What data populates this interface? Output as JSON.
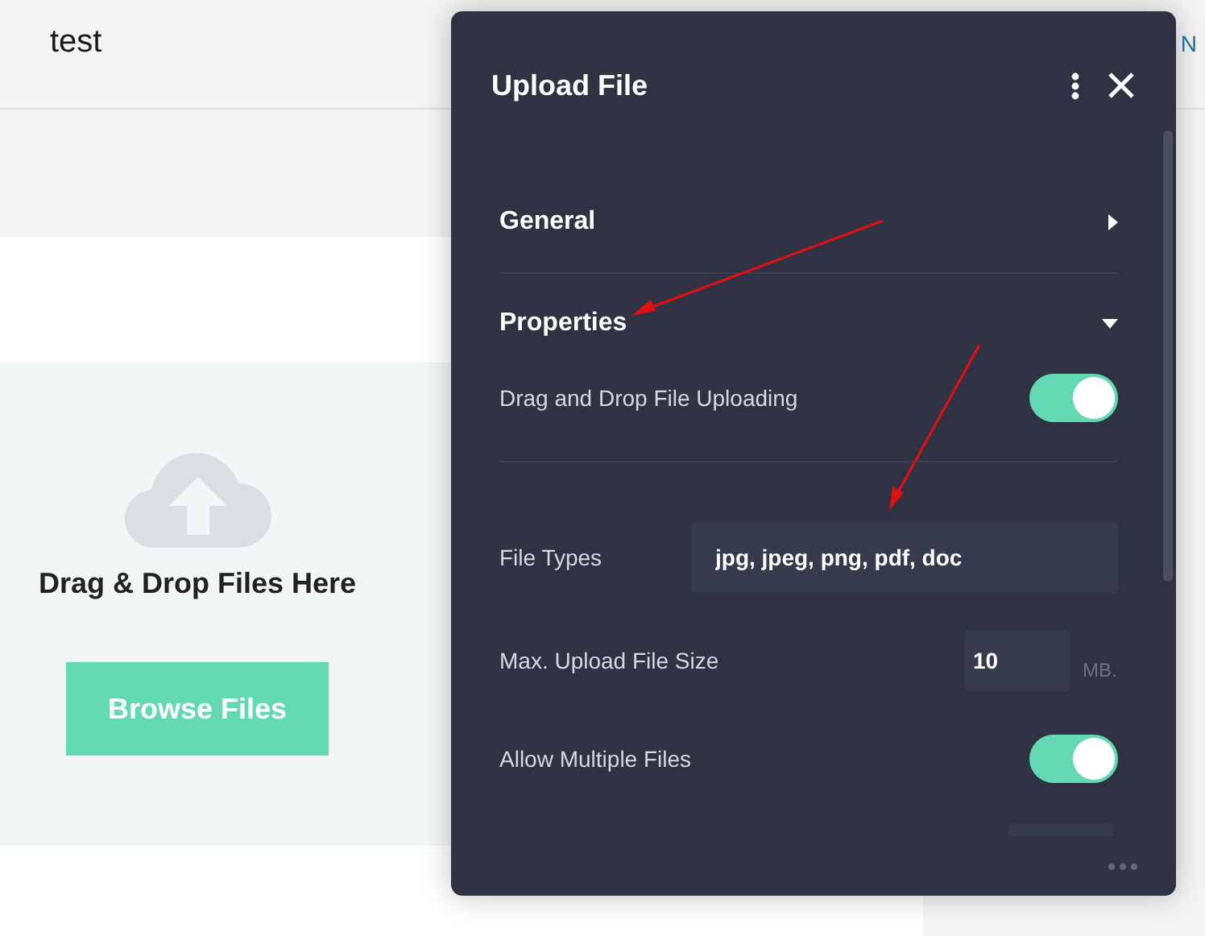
{
  "page": {
    "title": "test",
    "header_edge_text": "N",
    "dropzone": {
      "text": "Drag & Drop Files Here",
      "button": "Browse Files"
    }
  },
  "dialog": {
    "title": "Upload File",
    "sections": [
      {
        "label": "General",
        "expanded": false
      },
      {
        "label": "Properties",
        "expanded": true
      }
    ],
    "fields": [
      {
        "kind": "toggle",
        "label": "Drag and Drop File Uploading",
        "on": true
      },
      {
        "kind": "divider"
      },
      {
        "kind": "text",
        "label": "File Types",
        "value": "jpg, jpeg, png, pdf, doc"
      },
      {
        "kind": "number",
        "label": "Max. Upload File Size",
        "value": "10",
        "unit": "MB."
      },
      {
        "kind": "toggle",
        "label": "Allow Multiple Files",
        "on": true
      }
    ]
  }
}
